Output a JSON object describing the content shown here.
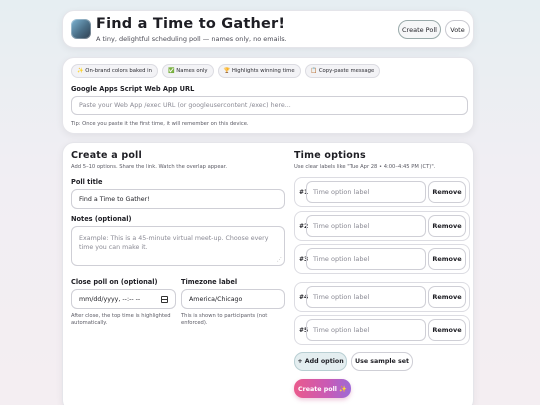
{
  "header": {
    "title": "Find a Time to Gather!",
    "subtitle": "A tiny, delightful scheduling poll — names only, no emails.",
    "create_poll_label": "Create Poll",
    "vote_label": "Vote"
  },
  "setup": {
    "chips": [
      "✨ On-brand colors baked in",
      "✅ Names only",
      "🏆 Highlights winning time",
      "📋 Copy-paste message"
    ],
    "url_label": "Google Apps Script Web App URL",
    "url_placeholder": "Paste your Web App /exec URL (or googleusercontent /exec) here...",
    "tip": "Tip: Once you paste it the first time, it will remember on this device."
  },
  "create": {
    "heading": "Create a poll",
    "hint": "Add 5–10 options. Share the link. Watch the overlap appear.",
    "poll_title_label": "Poll title",
    "poll_title_value": "Find a Time to Gather!",
    "notes_label": "Notes (optional)",
    "notes_placeholder": "Example: This is a 45-minute virtual meet-up. Choose every time you can make it.",
    "close_label": "Close poll on (optional)",
    "close_placeholder": "mm/dd/yyyy, --:-- --",
    "close_help": "After close, the top time is highlighted automatically.",
    "tz_label": "Timezone label",
    "tz_value": "America/Chicago",
    "tz_help": "This is shown to participants (not enforced)."
  },
  "time_options": {
    "heading": "Time options",
    "hint": "Use clear labels like \"Tue Apr 28 • 4:00–4:45 PM (CT)\".",
    "items": [
      {
        "num": "#1",
        "placeholder": "Time option label",
        "remove": "Remove"
      },
      {
        "num": "#2",
        "placeholder": "Time option label",
        "remove": "Remove"
      },
      {
        "num": "#3",
        "placeholder": "Time option label",
        "remove": "Remove"
      },
      {
        "num": "#4",
        "placeholder": "Time option label",
        "remove": "Remove"
      },
      {
        "num": "#5",
        "placeholder": "Time option label",
        "remove": "Remove"
      }
    ],
    "add_label": "+ Add option",
    "sample_label": "Use sample set",
    "create_label": "Create poll ✨"
  }
}
